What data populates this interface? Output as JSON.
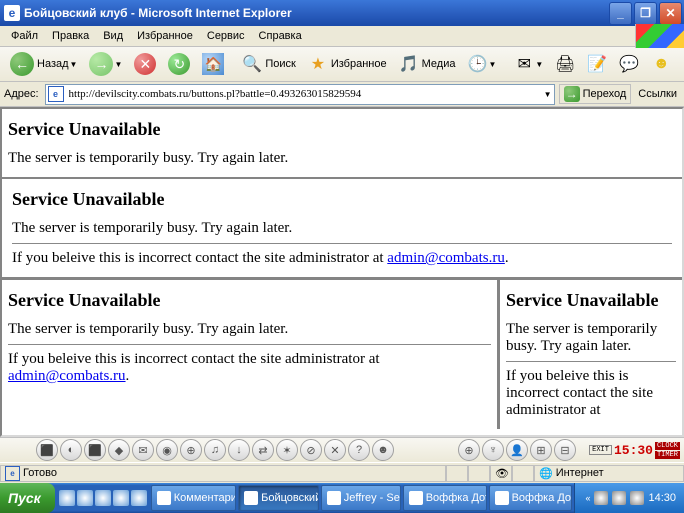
{
  "window": {
    "title": "Бойцовский клуб - Microsoft Internet Explorer"
  },
  "menu": {
    "file": "Файл",
    "edit": "Правка",
    "view": "Вид",
    "favorites": "Избранное",
    "tools": "Сервис",
    "help": "Справка"
  },
  "toolbar": {
    "back": "Назад",
    "search": "Поиск",
    "favorites": "Избранное",
    "media": "Медиа"
  },
  "address": {
    "label": "Адрес:",
    "url": "http://devilscity.combats.ru/buttons.pl?battle=0.493263015829594",
    "go": "Переход",
    "links": "Ссылки"
  },
  "error": {
    "heading": "Service Unavailable",
    "busy": "The server is temporarily busy. Try again later.",
    "contact_prefix": "If you beleive this is incorrect contact the site administrator at ",
    "email": "admin@combats.ru"
  },
  "clock": {
    "time": "15:30",
    "exit": "EXIT",
    "b1": "CLOCK",
    "b2": "TIMER"
  },
  "status": {
    "ready": "Готово",
    "zone": "Интернет"
  },
  "taskbar": {
    "start": "Пуск",
    "tasks": [
      "Комментарии...",
      "Бойцовский ...",
      "Jeffrey - Sea...",
      "Воффка Дот ...",
      "Воффка Дот ..."
    ],
    "tray_time": "14:30"
  }
}
